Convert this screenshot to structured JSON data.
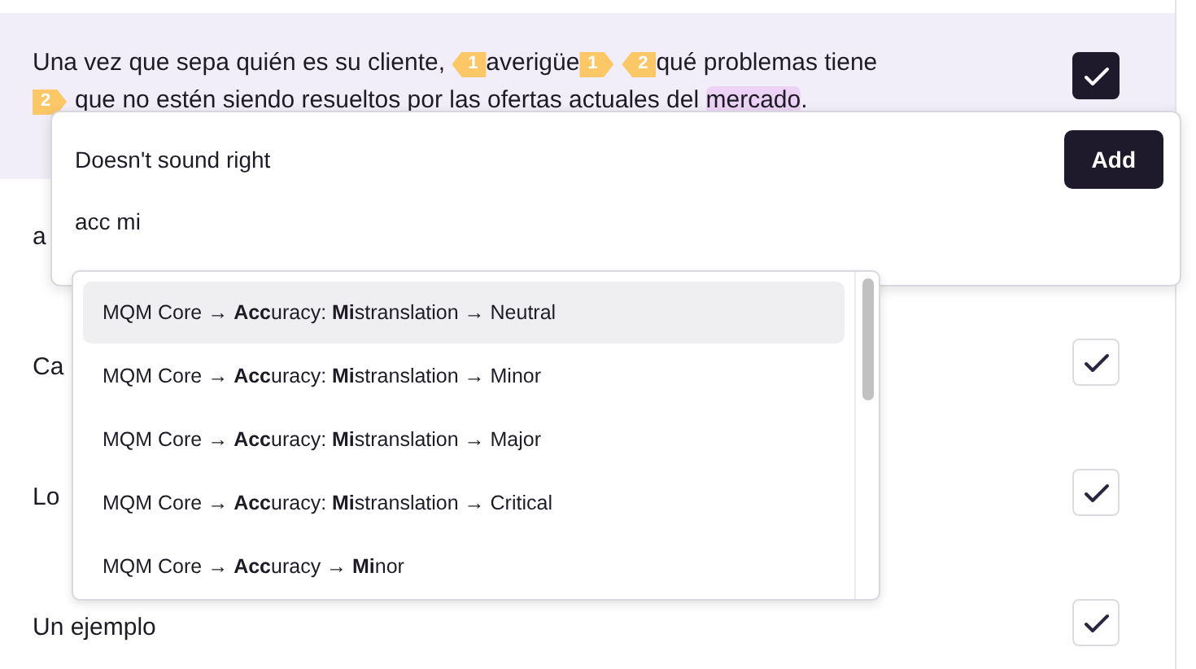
{
  "rows": [
    {
      "active": true,
      "checked": true,
      "segments": [
        {
          "kind": "text",
          "text": "Una vez que sepa quién es su cliente, "
        },
        {
          "kind": "tag",
          "text": "1",
          "closing": false
        },
        {
          "kind": "text",
          "text": "averigüe"
        },
        {
          "kind": "tag",
          "text": "1",
          "closing": true
        },
        {
          "kind": "tag",
          "text": "2",
          "closing": false
        },
        {
          "kind": "text",
          "text": "qué problemas tiene "
        },
        {
          "kind": "tag",
          "text": "2",
          "closing": true
        },
        {
          "kind": "text",
          "text": "que no estén siendo resueltos por las ofertas actuales del "
        },
        {
          "kind": "mark",
          "text": "mercado"
        },
        {
          "kind": "text",
          "text": "."
        }
      ]
    },
    {
      "active": false,
      "segments": [
        {
          "kind": "text",
          "text": "a"
        }
      ]
    },
    {
      "active": false,
      "checked": true,
      "segments": [
        {
          "kind": "text",
          "text": "Ca"
        }
      ]
    },
    {
      "active": false,
      "checked": true,
      "segments": [
        {
          "kind": "text",
          "text": "Lo"
        }
      ]
    },
    {
      "active": false,
      "checked": true,
      "segments": [
        {
          "kind": "text",
          "text": "Un ejemplo"
        }
      ]
    }
  ],
  "popup": {
    "comment": "Doesn't sound right",
    "add_button": "Add",
    "search_value": "acc mi",
    "options": [
      {
        "label": "MQM Core → **Acc**uracy: **Mi**stranslation → Neutral",
        "selected": true
      },
      {
        "label": "MQM Core → **Acc**uracy: **Mi**stranslation → Minor",
        "selected": false
      },
      {
        "label": "MQM Core → **Acc**uracy: **Mi**stranslation → Major",
        "selected": false
      },
      {
        "label": "MQM Core → **Acc**uracy: **Mi**stranslation → Critical",
        "selected": false
      },
      {
        "label": "MQM Core → **Acc**uracy → **Mi**nor",
        "selected": false
      }
    ]
  }
}
